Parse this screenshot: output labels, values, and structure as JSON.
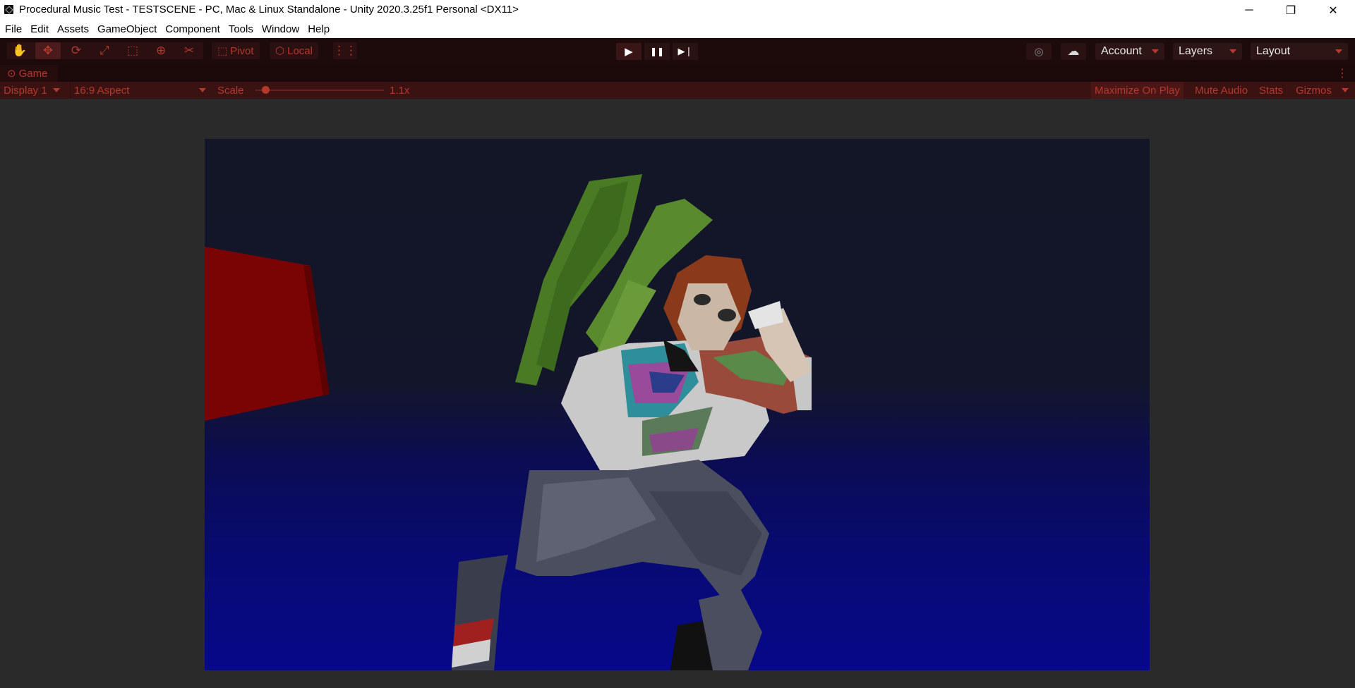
{
  "window": {
    "title": "Procedural Music Test - TESTSCENE - PC, Mac & Linux Standalone - Unity 2020.3.25f1 Personal <DX11>",
    "minimize_glyph": "─",
    "maximize_glyph": "❐",
    "close_glyph": "✕"
  },
  "menu": {
    "items": [
      "File",
      "Edit",
      "Assets",
      "GameObject",
      "Component",
      "Tools",
      "Window",
      "Help"
    ]
  },
  "toolbar": {
    "tools": [
      {
        "icon": "hand-icon",
        "glyph": "✋"
      },
      {
        "icon": "move-icon",
        "glyph": "✥"
      },
      {
        "icon": "rotate-icon",
        "glyph": "⟳"
      },
      {
        "icon": "scale-icon",
        "glyph": "⤢"
      },
      {
        "icon": "rect-tool-icon",
        "glyph": "⬚"
      },
      {
        "icon": "transform-icon",
        "glyph": "⊕"
      },
      {
        "icon": "custom-tool-icon",
        "glyph": "✂"
      }
    ],
    "pivot_label": "Pivot",
    "local_label": "Local",
    "grid_snap_glyph": "⋮⋮",
    "play_glyph": "▶",
    "pause_glyph": "❚❚",
    "step_glyph": "▶❘",
    "collab_glyph": "◎",
    "cloud_glyph": "☁",
    "account_label": "Account",
    "layers_label": "Layers",
    "layout_label": "Layout"
  },
  "game_tab": {
    "label": "Game",
    "icon": "game-controller-icon",
    "menu_glyph": "⋮"
  },
  "game_controls": {
    "display": "Display 1",
    "aspect": "16:9 Aspect",
    "scale_label": "Scale",
    "scale_value": "1.1x",
    "scale_fraction": 0.05,
    "maximize_on_play": "Maximize On Play",
    "mute_audio": "Mute Audio",
    "stats": "Stats",
    "gizmos": "Gizmos"
  },
  "colors": {
    "accent": "#b5382c",
    "toolbar_bg": "#1d0a0a",
    "control_row_bg": "#3b1212",
    "editor_bg": "#2a2a2a"
  }
}
